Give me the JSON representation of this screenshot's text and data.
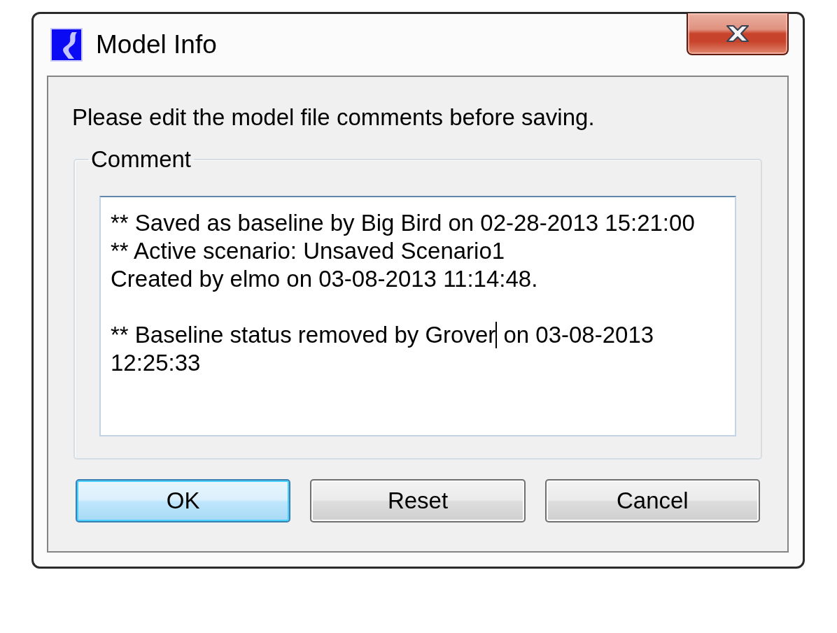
{
  "window": {
    "title": "Model Info"
  },
  "message": "Please edit the model file comments before saving.",
  "comment": {
    "label": "Comment",
    "paragraphs": [
      {
        "lines": [
          {
            "text": "** Saved as baseline by Big Bird on 02-28-2013 15:21:00"
          },
          {
            "text": "** Active scenario: Unsaved Scenario1"
          },
          {
            "text": "Created by elmo on 03-08-2013 11:14:48."
          }
        ]
      },
      {
        "lines": [
          {
            "text": "** Baseline status removed by Grover",
            "text_after_caret": " on 03-08-2013"
          },
          {
            "text": "12:25:33"
          }
        ]
      }
    ]
  },
  "buttons": [
    {
      "label": "OK",
      "default": true
    },
    {
      "label": "Reset",
      "default": false
    },
    {
      "label": "Cancel",
      "default": false
    }
  ]
}
